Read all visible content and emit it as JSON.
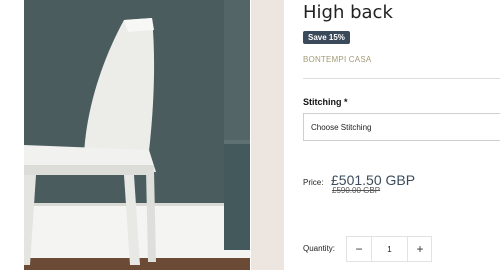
{
  "product": {
    "title": "High back",
    "badge": "Save 15%",
    "vendor": "BONTEMPI CASA",
    "option_label": "Stitching *",
    "option_selected": "Choose Stitching",
    "price_label": "Price:",
    "price": "£501.50 GBP",
    "compare_price": "£590.00 GBP",
    "quantity_label": "Quantity:",
    "quantity_value": "1",
    "minus": "−",
    "plus": "+"
  },
  "colors": {
    "wall": "#4c5e5f",
    "badge": "#3b4a5b",
    "vendor": "#a39a76",
    "strip": "#ede5e0"
  }
}
